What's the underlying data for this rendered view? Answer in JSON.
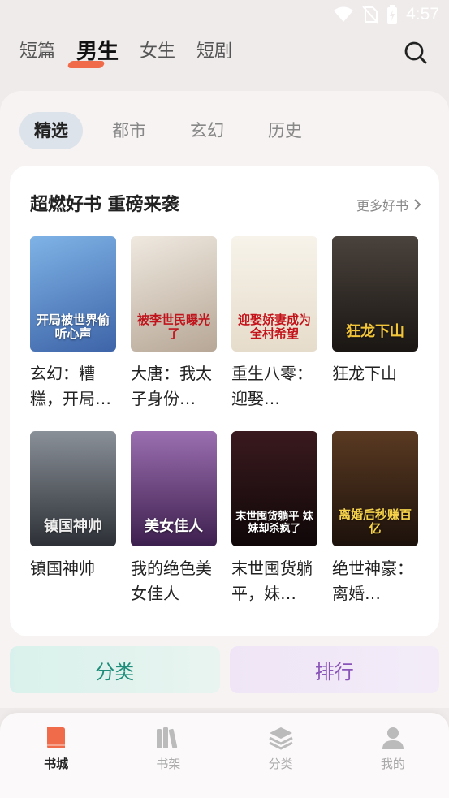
{
  "status": {
    "time": "4:57"
  },
  "top_tabs": [
    {
      "label": "短篇",
      "active": false
    },
    {
      "label": "男生",
      "active": true
    },
    {
      "label": "女生",
      "active": false
    },
    {
      "label": "短剧",
      "active": false
    }
  ],
  "sub_tabs": [
    {
      "label": "精选",
      "active": true
    },
    {
      "label": "都市",
      "active": false
    },
    {
      "label": "玄幻",
      "active": false
    },
    {
      "label": "历史",
      "active": false
    }
  ],
  "section": {
    "title": "超燃好书 重磅来袭",
    "more": "更多好书"
  },
  "books": [
    {
      "title": "玄幻：糟糕，开局…",
      "cover_text": "开局被世界偷听心声",
      "cover_bg": "#4a78b8",
      "cover_fg": "#ffffff"
    },
    {
      "title": "大唐：我太子身份…",
      "cover_text": "被李世民曝光了",
      "cover_bg": "#d8cfc4",
      "cover_fg": "#c0141c"
    },
    {
      "title": "重生八零：迎娶…",
      "cover_text": "迎娶娇妻成为全村希望",
      "cover_bg": "#f2ede2",
      "cover_fg": "#c4121a"
    },
    {
      "title": "狂龙下山",
      "cover_text": "狂龙下山",
      "cover_bg": "#2a2622",
      "cover_fg": "#f3c63a"
    },
    {
      "title": "镇国神帅",
      "cover_text": "镇国神帅",
      "cover_bg": "#3c4046",
      "cover_fg": "#e8e8e8"
    },
    {
      "title": "我的绝色美女佳人",
      "cover_text": "美女佳人",
      "cover_bg": "#5b2f6e",
      "cover_fg": "#ffffff"
    },
    {
      "title": "末世囤货躺平，妹…",
      "cover_text": "末世囤货躺平 妹妹却杀疯了",
      "cover_bg": "#1d1012",
      "cover_fg": "#ffffff"
    },
    {
      "title": "绝世神豪：离婚…",
      "cover_text": "离婚后秒赚百亿",
      "cover_bg": "#2b1a13",
      "cover_fg": "#f5d24a"
    }
  ],
  "features": {
    "category": "分类",
    "ranking": "排行"
  },
  "bottom_nav": [
    {
      "label": "书城",
      "icon": "book-icon",
      "active": true
    },
    {
      "label": "书架",
      "icon": "bookshelf-icon",
      "active": false
    },
    {
      "label": "分类",
      "icon": "layers-icon",
      "active": false
    },
    {
      "label": "我的",
      "icon": "user-icon",
      "active": false
    }
  ],
  "colors": {
    "accent": "#ef6b4a",
    "category_text": "#1e8d7a",
    "ranking_text": "#8a55b9"
  }
}
